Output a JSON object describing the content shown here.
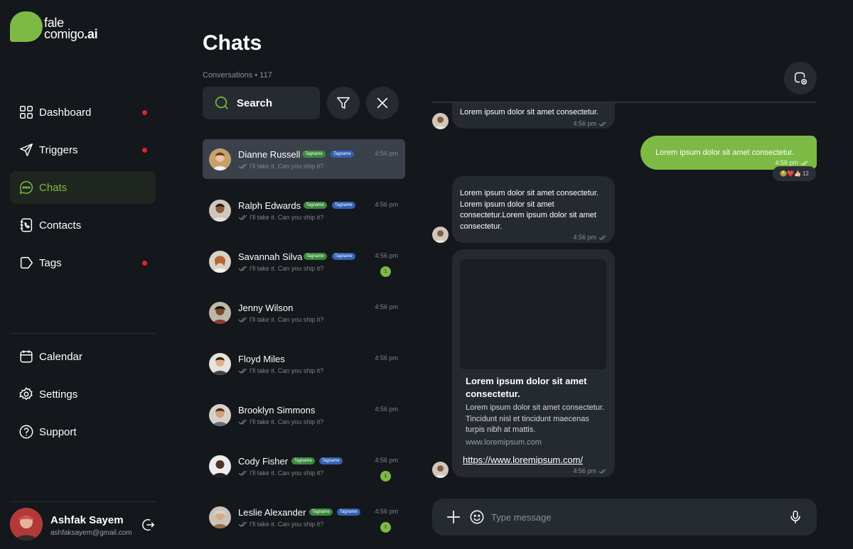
{
  "brand": {
    "line1": "fale",
    "line2": "comigo",
    "suffix": ".ai",
    "accent": "#7dba45"
  },
  "sidebar": {
    "items": [
      {
        "label": "Dashboard",
        "icon": "grid-icon",
        "dot": true
      },
      {
        "label": "Triggers",
        "icon": "send-icon",
        "dot": true
      },
      {
        "label": "Chats",
        "icon": "chat-bubble-icon",
        "active": true
      },
      {
        "label": "Contacts",
        "icon": "contacts-book-icon"
      },
      {
        "label": "Tags",
        "icon": "tag-icon",
        "dot": true
      }
    ],
    "bottom_items": [
      {
        "label": "Calendar",
        "icon": "calendar-icon"
      },
      {
        "label": "Settings",
        "icon": "gear-icon"
      },
      {
        "label": "Support",
        "icon": "question-circle-icon"
      }
    ],
    "user": {
      "name": "Ashfak Sayem",
      "email": "ashfaksayem@gmail.com"
    }
  },
  "chats": {
    "title": "Chats",
    "conversations_label": "Conversations • 117",
    "search_label": "Search",
    "list": [
      {
        "name": "Dianne Russell",
        "tags": [
          "Tagname",
          "Tagname"
        ],
        "message": "I'll take it. Can you ship it?",
        "time": "4:56 pm",
        "active": true
      },
      {
        "name": "Ralph Edwards",
        "tags": [
          "Tagname",
          "Tagname"
        ],
        "message": "I'll take it. Can you ship it?",
        "time": "4:56 pm"
      },
      {
        "name": "Savannah Silva",
        "tags": [
          "Tagname",
          "Tagname"
        ],
        "message": "I'll take it. Can you ship it?",
        "time": "4:56 pm",
        "unread": "1"
      },
      {
        "name": "Jenny Wilson",
        "tags": [],
        "message": "I'll take it. Can you ship it?",
        "time": "4:56 pm"
      },
      {
        "name": "Floyd Miles",
        "tags": [],
        "message": "I'll take it. Can you ship it?",
        "time": "4:56 pm"
      },
      {
        "name": "Brooklyn Simmons",
        "tags": [],
        "message": "I'll take it. Can you ship it?",
        "time": "4:56 pm"
      },
      {
        "name": "Cody Fisher",
        "tags": [
          "Tagname",
          "Tagname"
        ],
        "message": "I'll take it. Can you ship it?",
        "time": "4:56 pm",
        "unread": "1"
      },
      {
        "name": "Leslie Alexander",
        "tags": [
          "Tagname",
          "Tagname"
        ],
        "message": "I'll take it. Can you ship it?",
        "time": "4:56 pm",
        "unread": "1"
      }
    ]
  },
  "conversation": {
    "messages": [
      {
        "text": "Lorem ipsum dolor sit amet consectetur.",
        "time": "4:56 pm"
      },
      {
        "text": "Lorem ipsum dolor sit amet consectetur.",
        "time": "4:56 pm",
        "reactions": "😂❤️👍🏻",
        "reaction_count": "12"
      },
      {
        "text": "Lorem ipsum dolor sit amet consectetur. Lorem ipsum dolor sit amet consectetur.Lorem ipsum dolor sit amet consectetur.",
        "time": "4:56 pm"
      }
    ],
    "link_preview": {
      "title": "Lorem ipsum dolor sit amet consectetur.",
      "description": "Lorem ipsum dolor sit amet consectetur. Tincidunt nisl et tincidunt maecenas turpis nibh at mattis.",
      "domain": "www.loremipsum.com",
      "url": "https://www.loremipsum.com/",
      "time": "4:56 pm"
    },
    "composer_placeholder": "Type message"
  }
}
